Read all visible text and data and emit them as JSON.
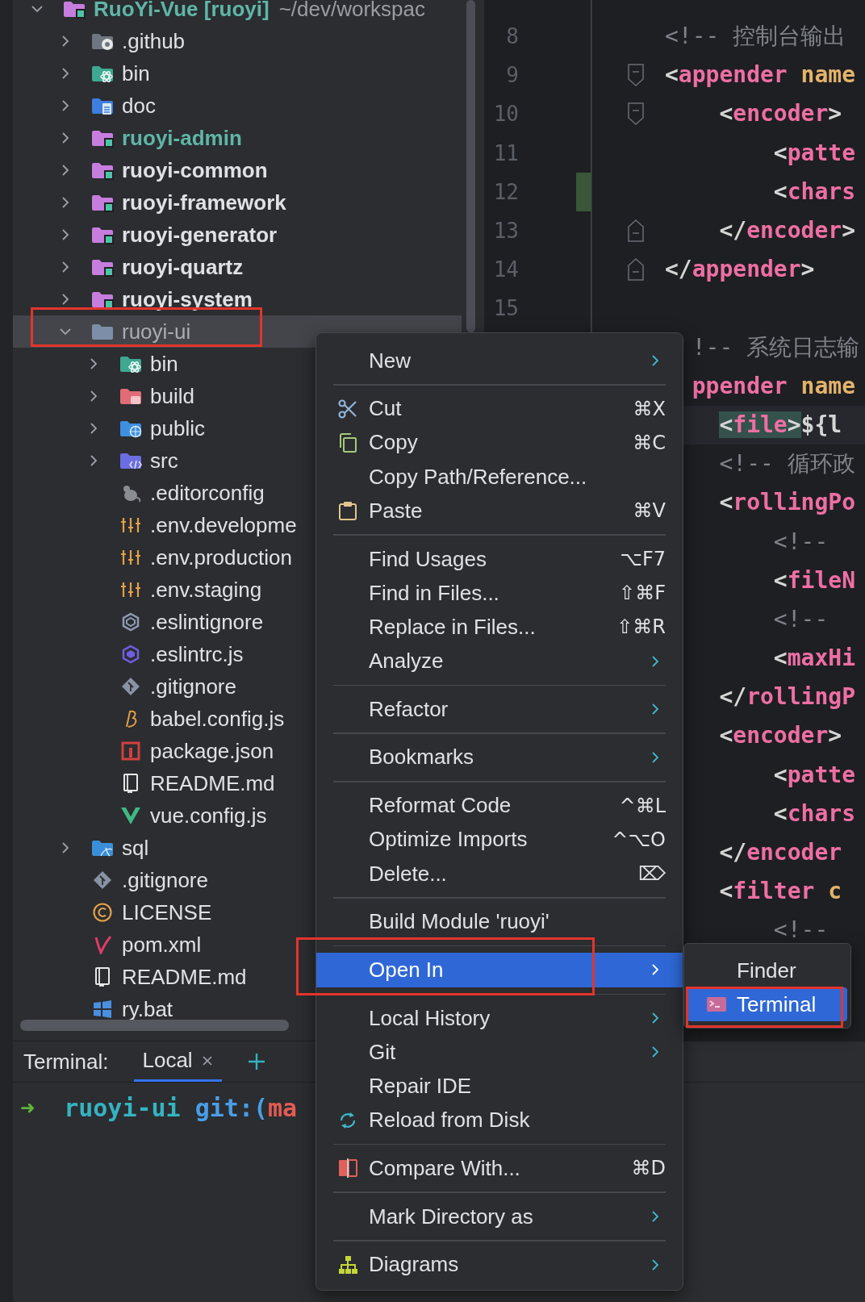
{
  "project_tree": {
    "items": [
      {
        "name": "RuoYi-Vue **[ruoyi]**",
        "path": "~/dev/workspac",
        "kind": "module",
        "color": "#5fb6a7",
        "expanded": true,
        "selected": false,
        "children": [
          {
            "name": ".github",
            "kind": "folder-github",
            "expanded": false,
            "selected": false
          },
          {
            "name": "bin",
            "kind": "folder-resources",
            "expanded": false,
            "selected": false
          },
          {
            "name": "doc",
            "kind": "folder-docs",
            "expanded": false,
            "selected": false
          },
          {
            "name": "ruoyi-admin",
            "kind": "module",
            "color": "#5fb6a7",
            "expanded": false,
            "selected": false
          },
          {
            "name": "ruoyi-common",
            "kind": "module",
            "expanded": false,
            "selected": false
          },
          {
            "name": "ruoyi-framework",
            "kind": "module",
            "expanded": false,
            "selected": false
          },
          {
            "name": "ruoyi-generator",
            "kind": "module",
            "expanded": false,
            "selected": false
          },
          {
            "name": "ruoyi-quartz",
            "kind": "module",
            "expanded": false,
            "selected": false
          },
          {
            "name": "ruoyi-system",
            "kind": "module",
            "expanded": false,
            "selected": false
          },
          {
            "name": "ruoyi-ui",
            "kind": "folder",
            "color": "#a9acb2",
            "expanded": true,
            "selected": true,
            "children": [
              {
                "name": "bin",
                "kind": "folder-resources",
                "expanded": false,
                "selected": false
              },
              {
                "name": "build",
                "kind": "folder-build",
                "expanded": false,
                "selected": false
              },
              {
                "name": "public",
                "kind": "folder-web",
                "expanded": false,
                "selected": false
              },
              {
                "name": "src",
                "kind": "folder-src",
                "expanded": false,
                "selected": false
              },
              {
                "name": ".editorconfig",
                "kind": "file-editorconfig",
                "selected": false
              },
              {
                "name": ".env.developme",
                "kind": "file-env",
                "selected": false
              },
              {
                "name": ".env.production",
                "kind": "file-env",
                "selected": false
              },
              {
                "name": ".env.staging",
                "kind": "file-env",
                "selected": false
              },
              {
                "name": ".eslintignore",
                "kind": "file-eslintignore",
                "selected": false
              },
              {
                "name": ".eslintrc.js",
                "kind": "file-eslint",
                "selected": false
              },
              {
                "name": ".gitignore",
                "kind": "file-git",
                "selected": false
              },
              {
                "name": "babel.config.js",
                "kind": "file-babel",
                "selected": false
              },
              {
                "name": "package.json",
                "kind": "file-npm",
                "selected": false
              },
              {
                "name": "README.md",
                "kind": "file-readme",
                "selected": false
              },
              {
                "name": "vue.config.js",
                "kind": "file-vue",
                "selected": false
              }
            ]
          },
          {
            "name": "sql",
            "kind": "folder-sql",
            "expanded": false,
            "selected": false
          },
          {
            "name": ".gitignore",
            "kind": "file-git",
            "selected": false
          },
          {
            "name": "LICENSE",
            "kind": "file-license",
            "selected": false
          },
          {
            "name": "pom.xml",
            "kind": "file-maven",
            "selected": false
          },
          {
            "name": "README.md",
            "kind": "file-readme",
            "selected": false
          },
          {
            "name": "ry.bat",
            "kind": "file-windows",
            "selected": false
          }
        ]
      }
    ]
  },
  "editor": {
    "lines": [
      {
        "number": "8",
        "tokens": [
          {
            "kind": "comment",
            "text": "<!-- 控制台输出"
          }
        ]
      },
      {
        "number": "9",
        "fold_start": true,
        "tokens": [
          {
            "kind": "punct",
            "text": "<"
          },
          {
            "kind": "tag",
            "text": "appender"
          },
          {
            "kind": "attr",
            "text": " name"
          }
        ]
      },
      {
        "number": "10",
        "fold_start": true,
        "tokens": [
          {
            "kind": "punct",
            "text": "    <"
          },
          {
            "kind": "tag",
            "text": "encoder"
          },
          {
            "kind": "punct",
            "text": ">"
          }
        ]
      },
      {
        "number": "11",
        "tokens": [
          {
            "kind": "punct",
            "text": "        <"
          },
          {
            "kind": "tag",
            "text": "patte"
          }
        ]
      },
      {
        "number": "12",
        "changed": true,
        "tokens": [
          {
            "kind": "punct",
            "text": "        <"
          },
          {
            "kind": "tag",
            "text": "chars"
          }
        ]
      },
      {
        "number": "13",
        "fold_end": true,
        "tokens": [
          {
            "kind": "punct",
            "text": "    </"
          },
          {
            "kind": "tag",
            "text": "encoder"
          },
          {
            "kind": "punct",
            "text": ">"
          }
        ]
      },
      {
        "number": "14",
        "fold_end": true,
        "tokens": [
          {
            "kind": "punct",
            "text": "</"
          },
          {
            "kind": "tag",
            "text": "appender"
          },
          {
            "kind": "punct",
            "text": ">"
          }
        ]
      },
      {
        "number": "15"
      },
      {
        "tokens": [
          {
            "kind": "comment",
            "text": "  !-- 系统日志输"
          }
        ]
      },
      {
        "tokens": [
          {
            "kind": "tag",
            "text": "  ppender"
          },
          {
            "kind": "attr",
            "text": " name"
          }
        ]
      },
      {
        "current": true,
        "tokens": [
          {
            "kind": "punct",
            "text": "    <",
            "matched": true
          },
          {
            "kind": "tag",
            "text": "file",
            "matched": true
          },
          {
            "kind": "punct",
            "text": ">",
            "matched": true
          },
          {
            "kind": "plain",
            "text": "${l"
          }
        ]
      },
      {
        "tokens": [
          {
            "kind": "comment",
            "text": "    <!-- 循环政"
          }
        ]
      },
      {
        "tokens": [
          {
            "kind": "punct",
            "text": "    <"
          },
          {
            "kind": "tag",
            "text": "rollingPo"
          }
        ]
      },
      {
        "tokens": [
          {
            "kind": "comment",
            "text": "        <!--"
          }
        ]
      },
      {
        "tokens": [
          {
            "kind": "punct",
            "text": "        <"
          },
          {
            "kind": "tag",
            "text": "fileN"
          }
        ]
      },
      {
        "tokens": [
          {
            "kind": "comment",
            "text": "        <!--"
          }
        ]
      },
      {
        "tokens": [
          {
            "kind": "punct",
            "text": "        <"
          },
          {
            "kind": "tag",
            "text": "maxHi"
          }
        ]
      },
      {
        "tokens": [
          {
            "kind": "punct",
            "text": "    </"
          },
          {
            "kind": "tag",
            "text": "rollingP"
          }
        ]
      },
      {
        "tokens": [
          {
            "kind": "punct",
            "text": "    <"
          },
          {
            "kind": "tag",
            "text": "encoder"
          },
          {
            "kind": "punct",
            "text": ">"
          }
        ]
      },
      {
        "tokens": [
          {
            "kind": "punct",
            "text": "        <"
          },
          {
            "kind": "tag",
            "text": "patte"
          }
        ]
      },
      {
        "tokens": [
          {
            "kind": "punct",
            "text": "        <"
          },
          {
            "kind": "tag",
            "text": "chars"
          }
        ]
      },
      {
        "tokens": [
          {
            "kind": "punct",
            "text": "    </"
          },
          {
            "kind": "tag",
            "text": "encoder"
          }
        ]
      },
      {
        "tokens": [
          {
            "kind": "punct",
            "text": "    <"
          },
          {
            "kind": "tag",
            "text": "filter"
          },
          {
            "kind": "attr",
            "text": " c"
          }
        ]
      },
      {
        "tokens": [
          {
            "kind": "comment",
            "text": "        <!--"
          }
        ]
      }
    ]
  },
  "terminal": {
    "title": "Terminal:",
    "tabs": [
      {
        "label": "Local",
        "selected": true
      }
    ],
    "prompt": {
      "symbol": "➜",
      "directory": "ruoyi-ui",
      "git": "git:(",
      "branch": "ma"
    }
  },
  "context_menu": {
    "items": [
      {
        "kind": "plain",
        "label": "New",
        "submenu": true,
        "selected": false
      },
      {
        "kind": "separator"
      },
      {
        "kind": "cut",
        "label": "Cut",
        "shortcut": "⌘X",
        "submenu": false,
        "selected": false
      },
      {
        "kind": "copy",
        "label": "Copy",
        "shortcut": "⌘C",
        "submenu": false,
        "selected": false
      },
      {
        "kind": "plain",
        "label": "Copy Path/Reference...",
        "submenu": false,
        "selected": false
      },
      {
        "kind": "paste",
        "label": "Paste",
        "shortcut": "⌘V",
        "submenu": false,
        "selected": false
      },
      {
        "kind": "separator"
      },
      {
        "kind": "plain",
        "label": "Find Usages",
        "shortcut": "⌥F7",
        "submenu": false,
        "selected": false
      },
      {
        "kind": "plain",
        "label": "Find in Files...",
        "shortcut": "⇧⌘F",
        "submenu": false,
        "selected": false
      },
      {
        "kind": "plain",
        "label": "Replace in Files...",
        "shortcut": "⇧⌘R",
        "submenu": false,
        "selected": false
      },
      {
        "kind": "plain",
        "label": "Analyze",
        "submenu": true,
        "selected": false
      },
      {
        "kind": "separator"
      },
      {
        "kind": "plain",
        "label": "Refactor",
        "submenu": true,
        "selected": false
      },
      {
        "kind": "separator"
      },
      {
        "kind": "plain",
        "label": "Bookmarks",
        "submenu": true,
        "selected": false
      },
      {
        "kind": "separator"
      },
      {
        "kind": "plain",
        "label": "Reformat Code",
        "shortcut": "^⌘L",
        "submenu": false,
        "selected": false
      },
      {
        "kind": "plain",
        "label": "Optimize Imports",
        "shortcut": "^⌥O",
        "submenu": false,
        "selected": false
      },
      {
        "kind": "plain",
        "label": "Delete...",
        "shortcut": "⌦",
        "submenu": false,
        "selected": false
      },
      {
        "kind": "separator"
      },
      {
        "kind": "plain",
        "label": "Build Module 'ruoyi'",
        "submenu": false,
        "selected": false
      },
      {
        "kind": "separator"
      },
      {
        "kind": "plain",
        "label": "Open In",
        "submenu": true,
        "selected": true
      },
      {
        "kind": "separator"
      },
      {
        "kind": "plain",
        "label": "Local History",
        "submenu": true,
        "selected": false
      },
      {
        "kind": "plain",
        "label": "Git",
        "submenu": true,
        "selected": false
      },
      {
        "kind": "plain",
        "label": "Repair IDE",
        "submenu": false,
        "selected": false
      },
      {
        "kind": "reload",
        "label": "Reload from Disk",
        "submenu": false,
        "selected": false
      },
      {
        "kind": "separator"
      },
      {
        "kind": "compare",
        "label": "Compare With...",
        "shortcut": "⌘D",
        "submenu": false,
        "selected": false
      },
      {
        "kind": "separator"
      },
      {
        "kind": "plain",
        "label": "Mark Directory as",
        "submenu": true,
        "selected": false
      },
      {
        "kind": "separator"
      },
      {
        "kind": "diagrams",
        "label": "Diagrams",
        "submenu": true,
        "selected": false
      }
    ]
  },
  "open_in_submenu": {
    "items": [
      {
        "kind": "plain",
        "label": "Finder",
        "selected": false
      },
      {
        "kind": "terminal",
        "label": "Terminal",
        "selected": true
      }
    ]
  }
}
